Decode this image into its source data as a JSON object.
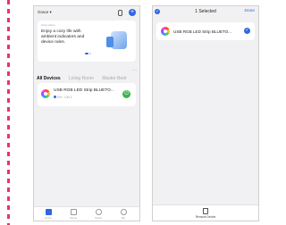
{
  "left_screen": {
    "home_name": "Grace ▾",
    "banner": {
      "tag": "Cozy Home",
      "title": "Enjoy a cozy life with ambient indicators and device rules."
    },
    "tabs": [
      "All Devices",
      "Living Room",
      "Master Bedr"
    ],
    "tab_more": "···",
    "device": {
      "name": "USB RGB LED Strip BLUETO...",
      "status": "0% · Ctrl 1"
    },
    "power_symbol": "⏻",
    "nav": [
      {
        "label": "Home",
        "active": true
      },
      {
        "label": "Scene",
        "active": false
      },
      {
        "label": "Smart",
        "active": false
      },
      {
        "label": "Me",
        "active": false
      }
    ]
  },
  "right_screen": {
    "check_symbol": "✓",
    "selected_text": "1 Selected",
    "done_label": "Done",
    "device_name": "USB RGB LED Strip BLUETO...",
    "remove_label": "Remove Device"
  },
  "colors": {
    "accent": "#2f66e3",
    "power_green": "#3cb54a",
    "dashed_line": "#e8336f"
  }
}
